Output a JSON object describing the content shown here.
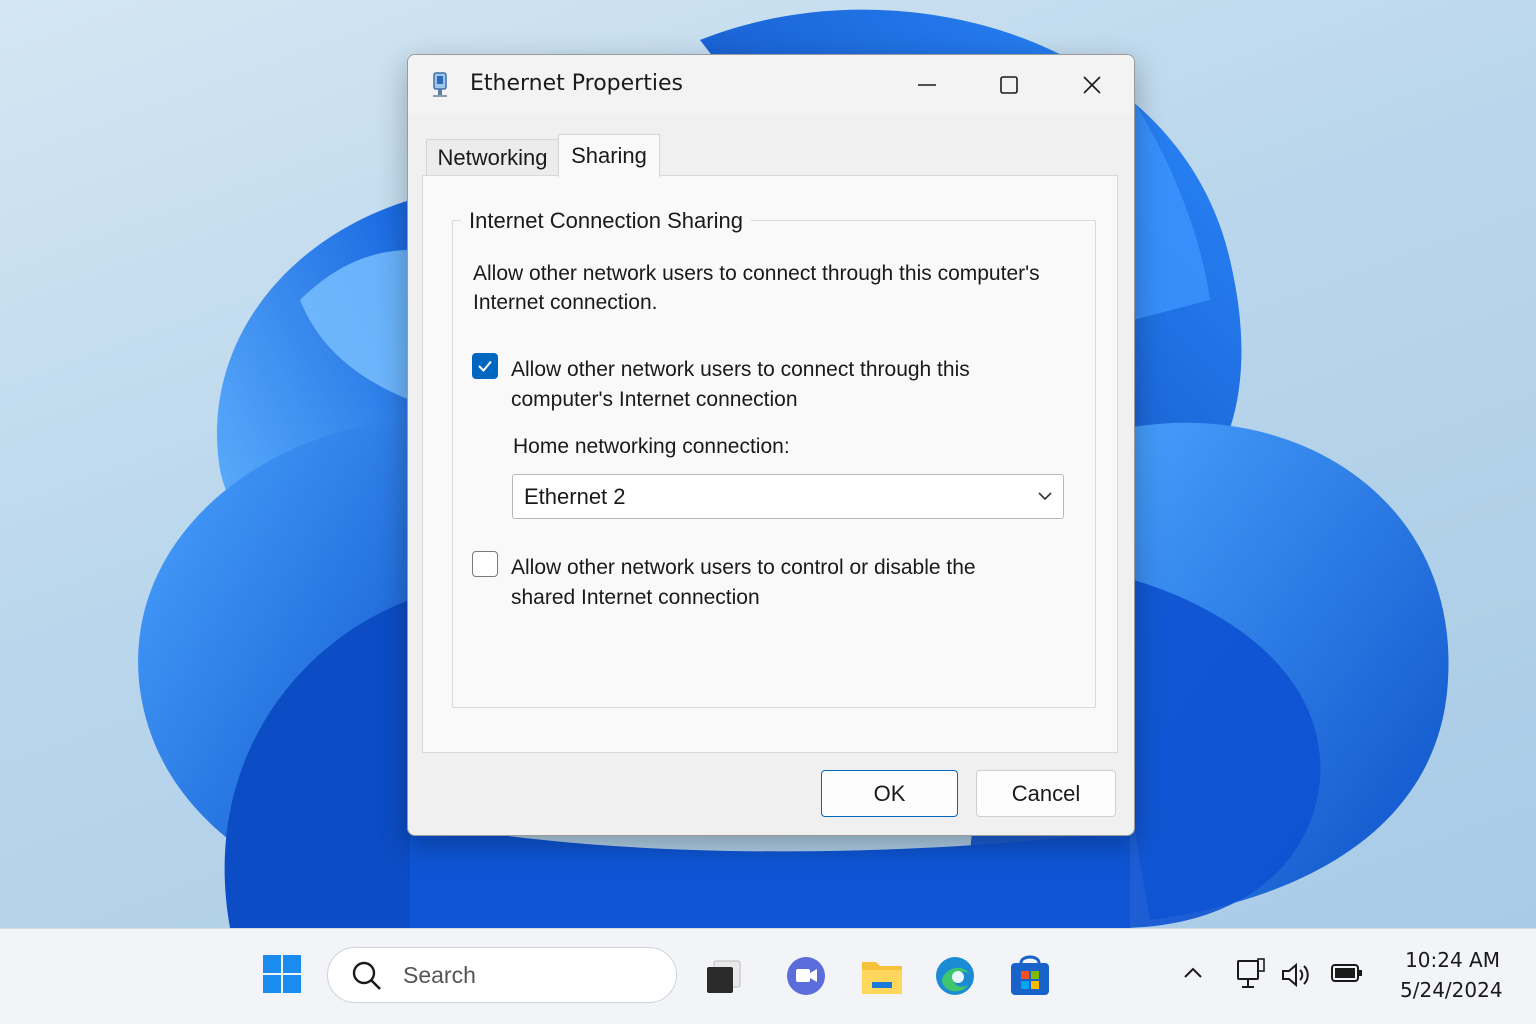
{
  "window": {
    "title": "Ethernet Properties"
  },
  "tabs": [
    {
      "label": "Networking",
      "selected": false
    },
    {
      "label": "Sharing",
      "selected": true
    }
  ],
  "sharing": {
    "group_title": "Internet Connection Sharing",
    "description": "Allow other network users to connect through this computer's Internet connection.",
    "allow_connect": {
      "label": "Allow other network users to connect through this computer's Internet connection",
      "checked": true
    },
    "home_networking_label": "Home networking connection:",
    "home_networking_value": "Ethernet 2",
    "allow_control": {
      "label": "Allow other network users to control or disable the shared Internet connection",
      "checked": false
    }
  },
  "buttons": {
    "ok": "OK",
    "cancel": "Cancel"
  },
  "taskbar": {
    "search_placeholder": "Search",
    "icons": [
      "windows-start-icon",
      "task-view-icon",
      "teams-chat-icon",
      "file-explorer-icon",
      "edge-browser-icon",
      "store-icon"
    ],
    "tray_icons": [
      "chevron-up-icon",
      "network-icon",
      "volume-icon",
      "battery-icon"
    ],
    "time": "10:24 AM",
    "date": "5/24/2024"
  },
  "colors": {
    "accent": "#0067c0",
    "wallpaper_bloom": "#1a6fe0"
  }
}
